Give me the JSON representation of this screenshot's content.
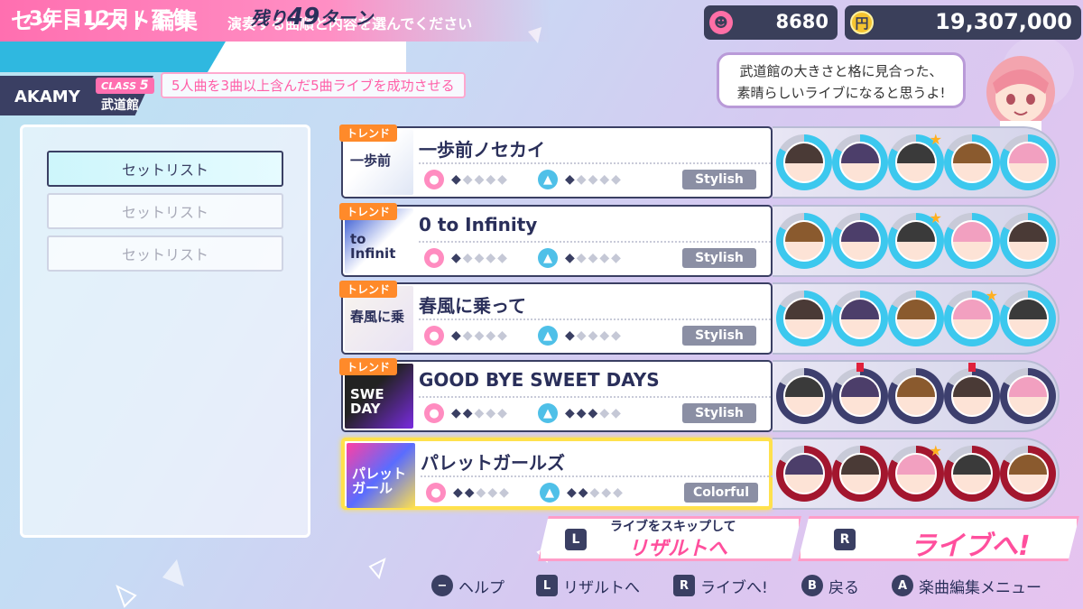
{
  "header": {
    "title": "セットリスト編集",
    "subtitle": "演奏する曲順と内容を選んでください",
    "date": "3年目12月 / 下旬",
    "turns_prefix": "残り",
    "turns_number": "49",
    "turns_suffix": "ターン",
    "unit": "AKAMY",
    "class_label": "CLASS",
    "class_number": "5",
    "venue": "武道館",
    "mission": "5人曲を3曲以上含んだ5曲ライブを成功させる"
  },
  "currency": {
    "fans": "8680",
    "money": "19,307,000"
  },
  "speech": {
    "line1": "武道館の大きさと格に見合った、",
    "line2": "素晴らしいライブになると思うよ!"
  },
  "setlists": [
    {
      "label": "セットリスト",
      "active": true
    },
    {
      "label": "セットリスト",
      "active": false
    },
    {
      "label": "セットリスト",
      "active": false
    }
  ],
  "songs": [
    {
      "title": "一歩前ノセカイ",
      "trend": "トレンド",
      "vocal": 1,
      "dance": 1,
      "style": "Stylish",
      "jacket_text": "一歩前"
    },
    {
      "title": "0 to Infinity",
      "trend": "トレンド",
      "vocal": 1,
      "dance": 1,
      "style": "Stylish",
      "jacket_text": "to Infinit"
    },
    {
      "title": "春風に乗って",
      "trend": "トレンド",
      "vocal": 1,
      "dance": 1,
      "style": "Stylish",
      "jacket_text": "春風に乗"
    },
    {
      "title": "GOOD BYE SWEET DAYS",
      "trend": "トレンド",
      "vocal": 2,
      "dance": 3,
      "style": "Stylish",
      "jacket_text": "SWE DAY"
    },
    {
      "title": "パレットガールズ",
      "trend": "",
      "vocal": 2,
      "dance": 2,
      "style": "Colorful",
      "jacket_text": "パレット ガール"
    }
  ],
  "buttons": {
    "skip_sub": "ライブをスキップして",
    "skip_main": "リザルトへ",
    "skip_key": "L",
    "live_main": "ライブへ!",
    "live_key": "R"
  },
  "help": [
    {
      "key": "−",
      "label": "ヘルプ"
    },
    {
      "key": "L",
      "label": "リザルトへ"
    },
    {
      "key": "R",
      "label": "ライブへ!"
    },
    {
      "key": "B",
      "label": "戻る"
    },
    {
      "key": "A",
      "label": "楽曲編集メニュー"
    }
  ],
  "colors": {
    "accent_pink": "#ff6fb0",
    "accent_blue": "#2fb8e0",
    "navy": "#3a3f63",
    "gold": "#f5c430",
    "selected": "#ffe14d"
  }
}
